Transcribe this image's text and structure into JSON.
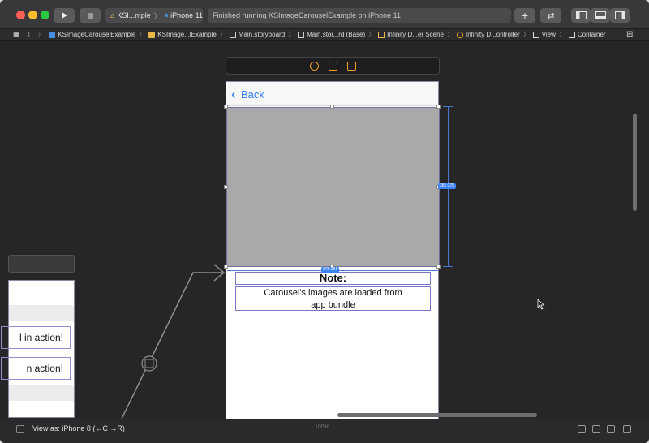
{
  "toolbar": {
    "scheme_name": "KSI...mple",
    "device": "iPhone 11",
    "status": "Finished running KSImageCarouselExample on iPhone 11"
  },
  "jumpbar": {
    "items": [
      "KSImageCarouselExample",
      "KSImage...lExample",
      "Main.storyboard",
      "Main.stor...rd (Base)",
      "Infinity D...er Scene",
      "Infinity D...ontroller",
      "View",
      "Container"
    ]
  },
  "scene": {
    "back_label": "Back",
    "note_title": "Note:",
    "note_body_line1": "Carousel's images are loaded from",
    "note_body_line2": "app bundle",
    "dim_height": "281:375",
    "dim_width": "375:281"
  },
  "left_scene": {
    "cell1": "l in action!",
    "cell2": "n action!"
  },
  "bottom": {
    "view_as": "View as: iPhone 8 (←C →R)",
    "zoom": "100%"
  },
  "colors": {
    "accent": "#2f7cf6",
    "canvas_bg": "#262628",
    "carousel_gray": "#a9a9a9"
  }
}
